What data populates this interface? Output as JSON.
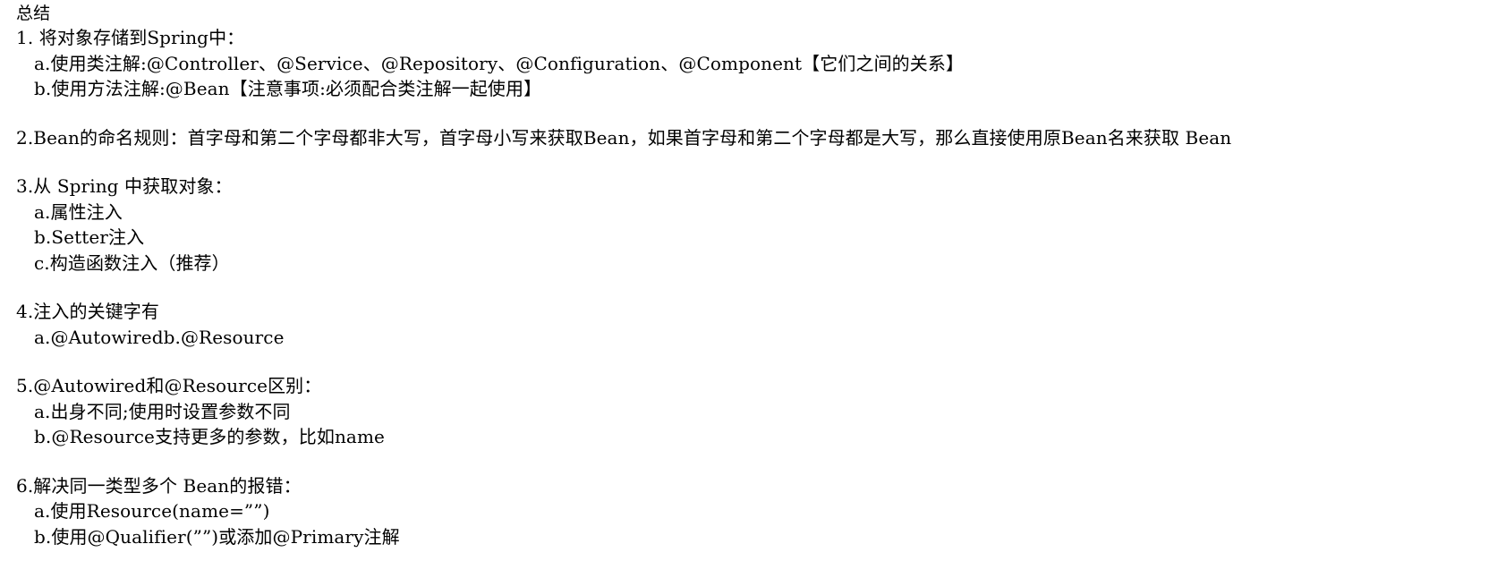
{
  "document": {
    "title": "总结",
    "sections": [
      {
        "id": "section-1",
        "heading": "1. 将对象存储到Spring中：",
        "items": [
          "a.使用类注解:@Controller、@Service、@Repository、@Configuration、@Component【它们之间的关系】",
          "b.使用方法注解:@Bean【注意事项:必须配合类注解一起使用】"
        ]
      },
      {
        "id": "section-2",
        "heading": "2.Bean的命名规则：首字母和第二个字母都非大写，首字母小写来获取Bean，如果首字母和第二个字母都是大写，那么直接使用原Bean名来获取 Bean",
        "items": []
      },
      {
        "id": "section-3",
        "heading": "3.从 Spring 中获取对象：",
        "items": [
          "a.属性注入",
          "b.Setter注入",
          "c.构造函数注入（推荐）"
        ]
      },
      {
        "id": "section-4",
        "heading": "4.注入的关键字有",
        "items": [
          "a.@Autowiredb.@Resource"
        ]
      },
      {
        "id": "section-5",
        "heading": "5.@Autowired和@Resource区别：",
        "items": [
          "a.出身不同;使用时设置参数不同",
          "b.@Resource支持更多的参数，比如name"
        ]
      },
      {
        "id": "section-6",
        "heading": "6.解决同一类型多个 Bean的报错：",
        "items": [
          "a.使用Resource(name=””)",
          "b.使用@Qualifier(””)或添加@Primary注解"
        ]
      }
    ]
  },
  "style": {
    "text_color": "#000000",
    "background_color": "#ffffff"
  }
}
